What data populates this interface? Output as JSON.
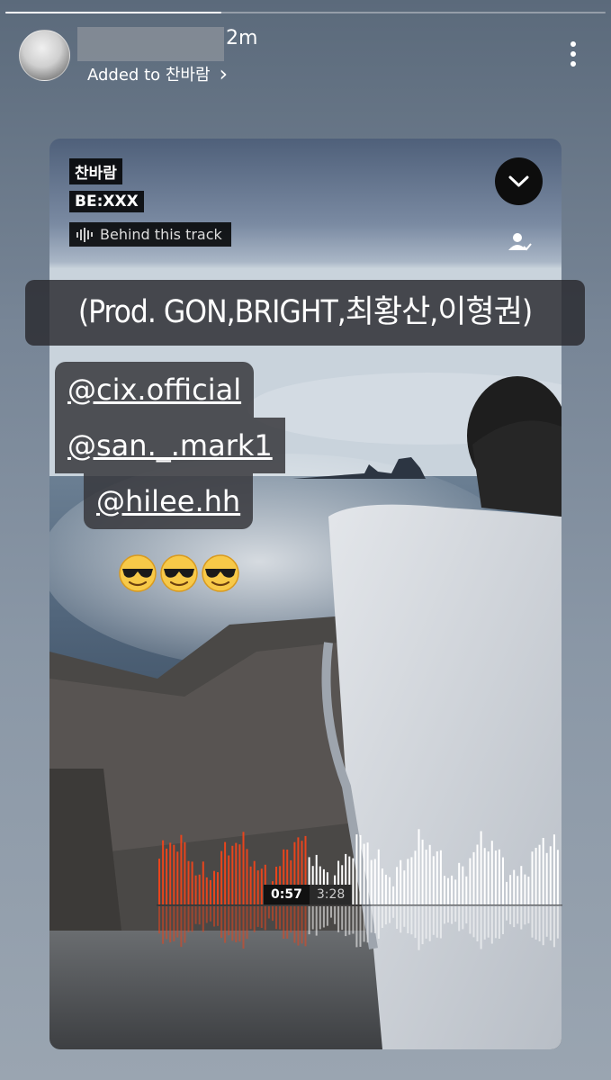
{
  "story": {
    "progress_fraction": 0.36
  },
  "header": {
    "time_ago": "2m",
    "added_to_label": "Added to 찬바람",
    "added_chevron": "›"
  },
  "track": {
    "title": "찬바람",
    "artist": "BE:XXX",
    "behind_label": "Behind this track",
    "current_time": "0:57",
    "total_time": "3:28",
    "played_fraction": 0.37
  },
  "caption": "(Prod. GON,BRIGHT,최황산,이형권)",
  "mentions": [
    "@cix.official",
    "@san._.mark1",
    "@hilee.hh"
  ],
  "emoji_count": 3,
  "colors": {
    "played": "#e8451d",
    "unplayed": "#ffffff"
  }
}
